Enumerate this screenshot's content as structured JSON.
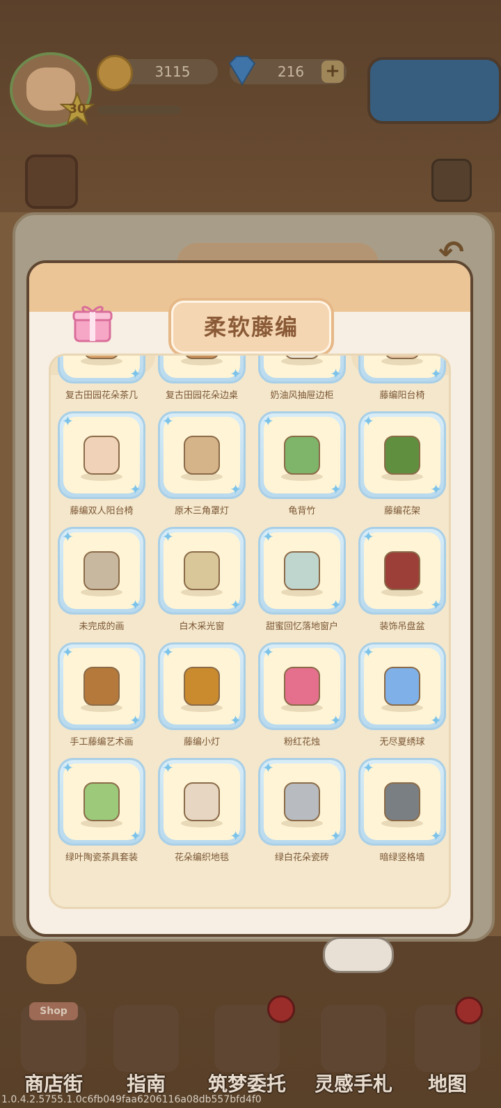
{
  "hud": {
    "level": "30",
    "coins": "3115",
    "gems": "216",
    "plus": "+"
  },
  "outer_panel": {
    "back": "↶"
  },
  "popup": {
    "title": "柔软藤编",
    "items": [
      {
        "label": "复古田园花朵茶几",
        "icon": "round-tea-table"
      },
      {
        "label": "复古田园花朵边桌",
        "icon": "side-table"
      },
      {
        "label": "奶油风抽屉边柜",
        "icon": "cream-cabinet"
      },
      {
        "label": "藤编阳台椅",
        "icon": "rattan-chair"
      },
      {
        "label": "藤编双人阳台椅",
        "icon": "rattan-sofa"
      },
      {
        "label": "原木三角罩灯",
        "icon": "tripod-lamp"
      },
      {
        "label": "龟背竹",
        "icon": "monstera-plant"
      },
      {
        "label": "藤编花架",
        "icon": "plant-stand"
      },
      {
        "label": "未完成的画",
        "icon": "unfinished-painting"
      },
      {
        "label": "白木采光窗",
        "icon": "white-wood-window"
      },
      {
        "label": "甜蜜回忆落地窗户",
        "icon": "arched-window"
      },
      {
        "label": "装饰吊盘盆",
        "icon": "hanging-planter"
      },
      {
        "label": "手工藤编艺术画",
        "icon": "rattan-art"
      },
      {
        "label": "藤编小灯",
        "icon": "rattan-lantern"
      },
      {
        "label": "粉红花烛",
        "icon": "anthurium"
      },
      {
        "label": "无尽夏绣球",
        "icon": "hydrangea"
      },
      {
        "label": "绿叶陶瓷茶具套装",
        "icon": "tea-set"
      },
      {
        "label": "花朵编织地毯",
        "icon": "flower-rug"
      },
      {
        "label": "绿白花朵瓷砖",
        "icon": "tile"
      },
      {
        "label": "暗绿竖格墙",
        "icon": "grid-wall"
      }
    ]
  },
  "nav": [
    {
      "label": "商店街",
      "icon": "shop-icon",
      "sign": "Shop"
    },
    {
      "label": "指南",
      "icon": "guide-icon"
    },
    {
      "label": "筑梦委托",
      "icon": "commission-icon"
    },
    {
      "label": "灵感手札",
      "icon": "notebook-icon"
    },
    {
      "label": "地图",
      "icon": "map-icon"
    }
  ],
  "version": "1.0.4.2.5755.1.0c6fb049faa6206116a08db557bfd4f0"
}
